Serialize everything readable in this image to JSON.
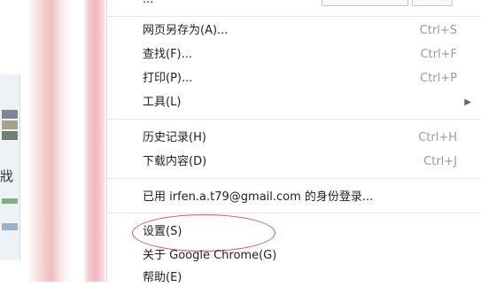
{
  "background": {
    "partial_left_text": "戕"
  },
  "menu": {
    "top_partial": "...",
    "items": [
      {
        "label": "网页另存为(A)...",
        "shortcut": "Ctrl+S"
      },
      {
        "label": "查找(F)...",
        "shortcut": "Ctrl+F"
      },
      {
        "label": "打印(P)...",
        "shortcut": "Ctrl+P"
      },
      {
        "label": "工具(L)",
        "submenu": true
      },
      {
        "label": "历史记录(H)",
        "shortcut": "Ctrl+H"
      },
      {
        "label": "下载内容(D)",
        "shortcut": "Ctrl+J"
      },
      {
        "label": "已用 irfen.a.t79@gmail.com 的身份登录..."
      },
      {
        "label": "设置(S)"
      },
      {
        "label": "关于 Google Chrome(G)"
      },
      {
        "label": "帮助(E)"
      }
    ]
  },
  "colors": {
    "highlight_ring": "#c7595b",
    "shortcut_text": "#9a9a9a"
  }
}
